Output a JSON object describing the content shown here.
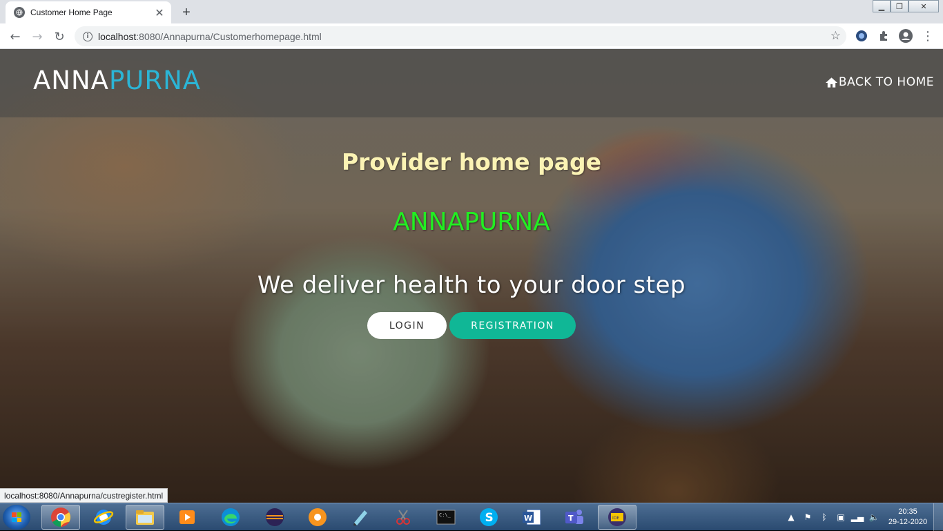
{
  "browser": {
    "tab_title": "Customer Home Page",
    "tab_close": "✕",
    "new_tab": "+",
    "url_host": "localhost",
    "url_rest": ":8080/Annapurna/Customerhomepage.html",
    "status_url": "localhost:8080/Annapurna/custregister.html"
  },
  "header": {
    "logo_part1": "ANNA",
    "logo_part2": "PURNA",
    "back_home": "BACK TO HOME"
  },
  "hero": {
    "title": "Provider home page",
    "brand": "ANNAPURNA",
    "tagline": "We deliver health to your door step",
    "login_label": "LOGIN",
    "register_label": "REGISTRATION"
  },
  "taskbar": {
    "time": "20:35",
    "date": "29-12-2020",
    "apps": [
      "chrome-icon",
      "internet-explorer-icon",
      "file-explorer-icon",
      "media-player-icon",
      "edge-icon",
      "eclipse-icon",
      "app-icon",
      "notepad-icon",
      "snipping-tool-icon",
      "command-prompt-icon",
      "skype-icon",
      "word-icon",
      "teams-icon",
      "java-ee-ide-icon"
    ]
  },
  "colors": {
    "logo_accent": "#2bb5d6",
    "title_color": "#fbf3b4",
    "brand_color": "#22ee22",
    "register_button": "#10b796"
  }
}
